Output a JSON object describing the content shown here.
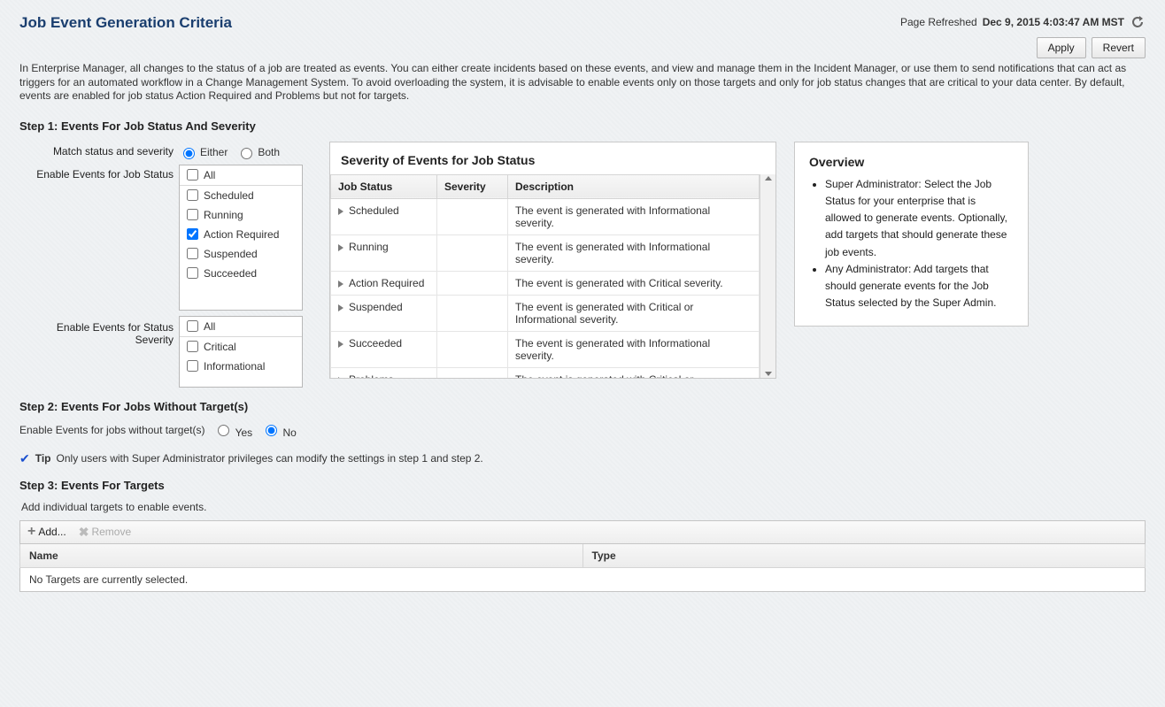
{
  "header": {
    "title": "Job Event Generation Criteria",
    "refresh_label": "Page Refreshed",
    "refresh_time": "Dec 9, 2015 4:03:47 AM MST",
    "apply": "Apply",
    "revert": "Revert"
  },
  "intro": "In Enterprise Manager, all changes to the status of a job are treated as events. You can either create incidents based on these events, and view and manage them in the Incident Manager, or use them to send notifications that can act as triggers for an automated workflow in a Change Management System. To avoid overloading the system, it is advisable to enable events only on those targets and only for job status changes that are critical to your data center. By default, events are enabled for job status Action Required and Problems but not for targets.",
  "step1": {
    "heading": "Step 1: Events For Job Status And Severity",
    "match_label": "Match status and severity",
    "either": "Either",
    "both": "Both",
    "enable_status_label": "Enable Events for Job Status",
    "enable_severity_label": "Enable Events for Status Severity",
    "all": "All",
    "status_items": [
      {
        "label": "Scheduled",
        "checked": false
      },
      {
        "label": "Running",
        "checked": false
      },
      {
        "label": "Action Required",
        "checked": true
      },
      {
        "label": "Suspended",
        "checked": false
      },
      {
        "label": "Succeeded",
        "checked": false
      }
    ],
    "severity_items": [
      {
        "label": "Critical",
        "checked": false
      },
      {
        "label": "Informational",
        "checked": false
      }
    ],
    "sev_panel_title": "Severity of Events for Job Status",
    "sev_columns": {
      "c1": "Job Status",
      "c2": "Severity",
      "c3": "Description"
    },
    "sev_rows": [
      {
        "status": "Scheduled",
        "desc": "The event is generated with Informational severity."
      },
      {
        "status": "Running",
        "desc": "The event is generated with Informational severity."
      },
      {
        "status": "Action Required",
        "desc": "The event is generated with Critical severity."
      },
      {
        "status": "Suspended",
        "desc": "The event is generated with Critical or Informational severity."
      },
      {
        "status": "Succeeded",
        "desc": "The event is generated with Informational severity."
      },
      {
        "status": "Problems",
        "desc": "The event is generated with Critical or Informational severity."
      }
    ],
    "overview_title": "Overview",
    "overview_bullets": [
      "Super Administrator: Select the Job Status for your enterprise that is allowed to generate events. Optionally, add targets that should generate these job events.",
      "Any Administrator: Add targets that should generate events for the Job Status selected by the Super Admin."
    ]
  },
  "step2": {
    "heading": "Step 2: Events For Jobs Without Target(s)",
    "enable_label": "Enable Events for jobs without target(s)",
    "yes": "Yes",
    "no": "No",
    "tip_label": "Tip",
    "tip_text": "Only users with Super Administrator privileges can modify the settings in step 1 and step 2."
  },
  "step3": {
    "heading": "Step 3: Events For Targets",
    "subnote": "Add individual targets to enable events.",
    "add": "Add...",
    "remove": "Remove",
    "col_name": "Name",
    "col_type": "Type",
    "empty": "No Targets are currently selected."
  }
}
